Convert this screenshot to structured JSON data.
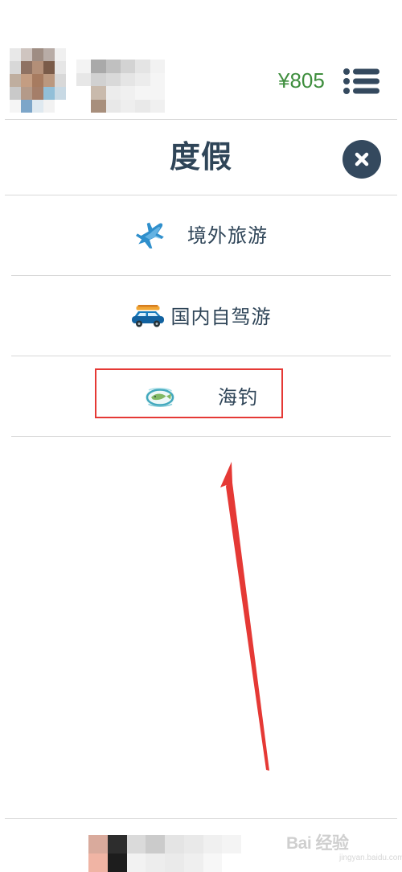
{
  "header": {
    "balance": "¥805"
  },
  "panel": {
    "title": "度假"
  },
  "menu": {
    "items": [
      {
        "label": "境外旅游",
        "icon": "airplane-icon"
      },
      {
        "label": "国内自驾游",
        "icon": "car-with-luggage-icon"
      },
      {
        "label": "海钓",
        "icon": "fishing-icon"
      }
    ]
  },
  "watermark": {
    "text": "Bai 经验",
    "subtext": "jingyan.baidu.com"
  },
  "colors": {
    "title": "#2f4558",
    "balance": "#3f8e3e",
    "close_button": "#34495e",
    "highlight": "#e53935",
    "arrow": "#e53935"
  }
}
